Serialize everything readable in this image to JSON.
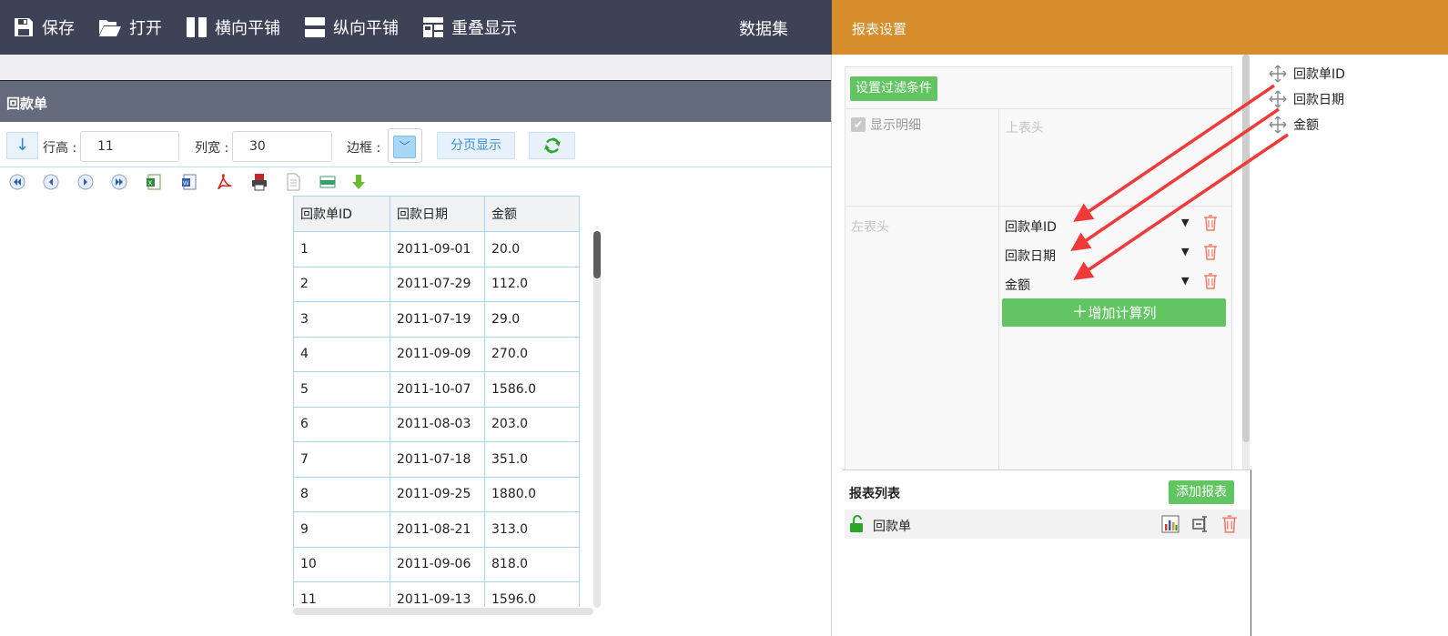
{
  "toolbar": {
    "buttons": [
      {
        "label": "保存",
        "icon": "save-icon"
      },
      {
        "label": "打开",
        "icon": "folder-open-icon"
      },
      {
        "label": "横向平铺",
        "icon": "tile-horizontal-icon"
      },
      {
        "label": "纵向平铺",
        "icon": "tile-vertical-icon"
      },
      {
        "label": "重叠显示",
        "icon": "cascade-icon"
      }
    ],
    "dataset_title": "数据集"
  },
  "settings_header": "报表设置",
  "report": {
    "title": "回款单",
    "options": {
      "row_height_label": "行高 :",
      "row_height_value": "11",
      "col_width_label": "列宽 :",
      "col_width_value": "30",
      "border_label": "边框 :",
      "paged_label": "分页显示"
    },
    "table": {
      "headers": [
        "回款单ID",
        "回款日期",
        "金额"
      ],
      "rows": [
        [
          "1",
          "2011-09-01",
          "20.0"
        ],
        [
          "2",
          "2011-07-29",
          "112.0"
        ],
        [
          "3",
          "2011-07-19",
          "29.0"
        ],
        [
          "4",
          "2011-09-09",
          "270.0"
        ],
        [
          "5",
          "2011-10-07",
          "1586.0"
        ],
        [
          "6",
          "2011-08-03",
          "203.0"
        ],
        [
          "7",
          "2011-07-18",
          "351.0"
        ],
        [
          "8",
          "2011-09-25",
          "1880.0"
        ],
        [
          "9",
          "2011-08-21",
          "313.0"
        ],
        [
          "10",
          "2011-09-06",
          "818.0"
        ],
        [
          "11",
          "2011-09-13",
          "1596.0"
        ]
      ]
    }
  },
  "settings": {
    "filter_button": "设置过滤条件",
    "show_detail_label": "显示明细",
    "top_header_label": "上表头",
    "left_header_label": "左表头",
    "fields": [
      "回款单ID",
      "回款日期",
      "金额"
    ],
    "add_calc_button": "增加计算列"
  },
  "report_list": {
    "title": "报表列表",
    "add_button": "添加报表",
    "items": [
      {
        "name": "回款单"
      }
    ]
  },
  "dataset_fields": [
    "回款单ID",
    "回款日期",
    "金额"
  ],
  "colors": {
    "toolbar_bg": "#3d4256",
    "settings_header_bg": "#d88d2c",
    "green": "#62c562",
    "arrow_red": "#f03a3a"
  }
}
